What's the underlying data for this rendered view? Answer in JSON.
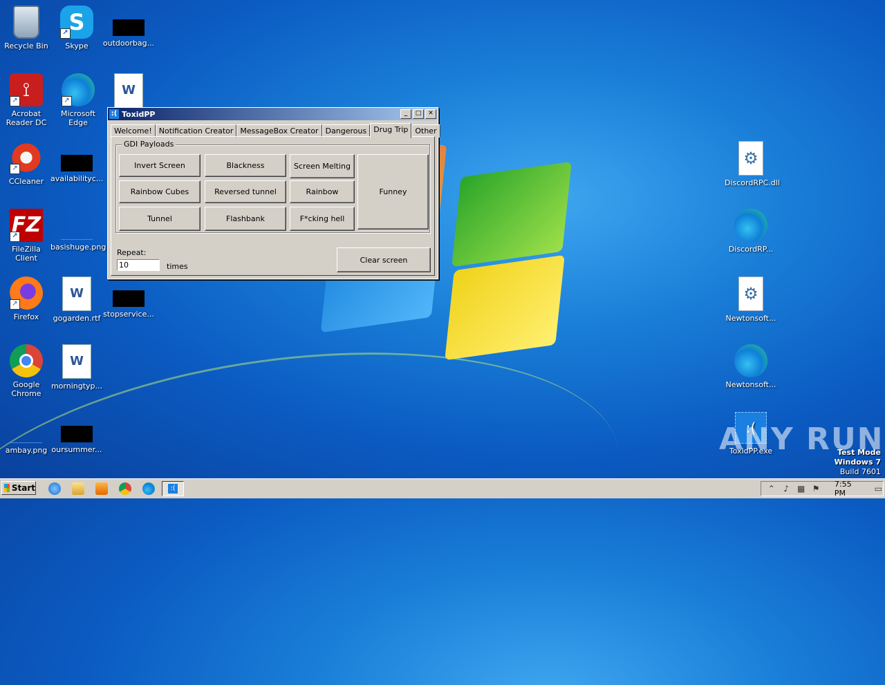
{
  "desktop": {
    "icons": [
      {
        "label": "Recycle Bin",
        "icon": "recycle-bin-icon"
      },
      {
        "label": "Skype",
        "icon": "skype-icon"
      },
      {
        "label": "outdoorbag...",
        "icon": "redacted-file-icon"
      },
      {
        "label": "Acrobat Reader DC",
        "icon": "acrobat-icon"
      },
      {
        "label": "Microsoft Edge",
        "icon": "edge-icon"
      },
      {
        "label": "",
        "icon": "word-document-icon"
      },
      {
        "label": "CCleaner",
        "icon": "ccleaner-icon"
      },
      {
        "label": "availabilityc...",
        "icon": "redacted-file-icon"
      },
      {
        "label": "FileZilla Client",
        "icon": "filezilla-icon"
      },
      {
        "label": "basishuge.png",
        "icon": "image-file-icon"
      },
      {
        "label": "Firefox",
        "icon": "firefox-icon"
      },
      {
        "label": "gogarden.rtf",
        "icon": "word-document-icon"
      },
      {
        "label": "stopservice...",
        "icon": "redacted-file-icon"
      },
      {
        "label": "Google Chrome",
        "icon": "chrome-icon"
      },
      {
        "label": "morningtyp...",
        "icon": "word-document-icon"
      },
      {
        "label": "ambay.png",
        "icon": "image-file-icon"
      },
      {
        "label": "oursummer...",
        "icon": "redacted-file-icon"
      },
      {
        "label": "DiscordRPC.dll",
        "icon": "dll-file-icon"
      },
      {
        "label": "DiscordRP...",
        "icon": "edge-icon"
      },
      {
        "label": "Newtonsoft...",
        "icon": "dll-file-icon"
      },
      {
        "label": "Newtonsoft...",
        "icon": "edge-icon"
      },
      {
        "label": "ToxidPP.exe",
        "icon": "toxidpp-exe-icon"
      }
    ]
  },
  "window": {
    "title": "ToxidPP",
    "app_icon_glyph": ":(",
    "controls": {
      "minimize": "_",
      "maximize": "□",
      "close": "✕"
    },
    "tabs": [
      "Welcome!",
      "Notification Creator",
      "MessageBox Creator",
      "Dangerous",
      "Drug Trip",
      "Other"
    ],
    "active_tab": "Drug Trip",
    "group_title": "GDI Payloads",
    "payload_buttons": [
      "Invert Screen",
      "Blackness",
      "Screen Melting",
      "Rainbow Cubes",
      "Reversed tunnel",
      "Rainbow",
      "Tunnel",
      "Flashbank",
      "F*cking hell"
    ],
    "big_button": "Funney",
    "repeat_label": "Repeat:",
    "repeat_value": "10",
    "times_label": "times",
    "clear_button": "Clear screen"
  },
  "taskbar": {
    "start_label": "Start",
    "quicklaunch": [
      "ie-icon",
      "explorer-icon",
      "media-player-icon",
      "chrome-icon",
      "edge-icon"
    ],
    "active_task_glyph": ":(",
    "tray_icons": [
      "show-hidden-icon",
      "volume-icon",
      "network-icon",
      "action-center-flag-icon"
    ],
    "clock": "7:55 PM"
  },
  "watermark": {
    "line1": "Test Mode",
    "line2": "Windows 7",
    "line3": "Build 7601"
  },
  "overlay_brand": "ANY RUN"
}
